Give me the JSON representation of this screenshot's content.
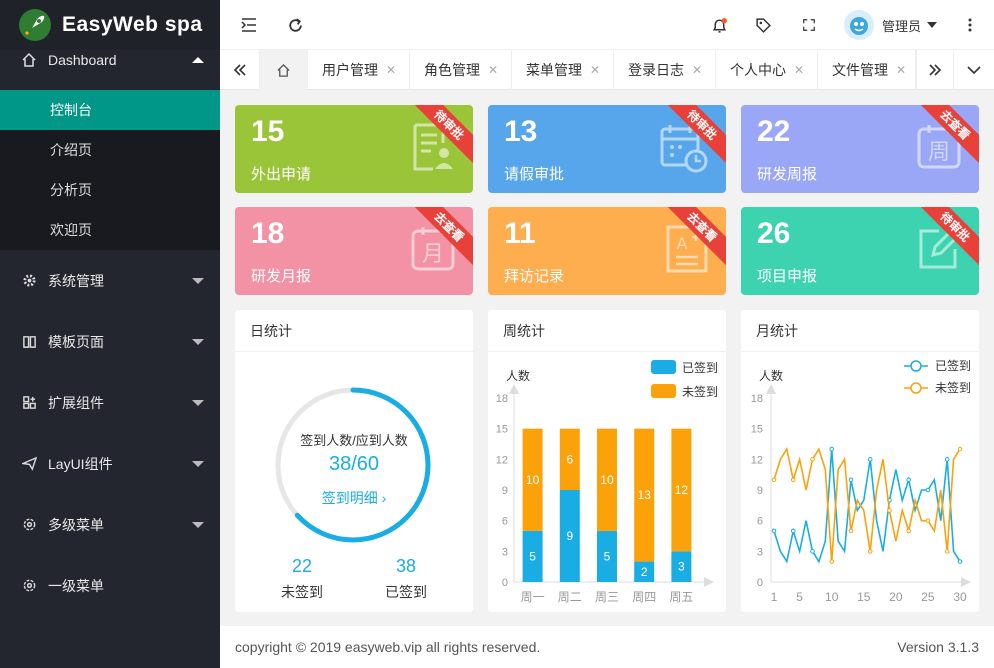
{
  "app": {
    "title": "EasyWeb spa"
  },
  "header": {
    "username": "管理员"
  },
  "sidebar": {
    "dashboard": "Dashboard",
    "dashboard_items": [
      "控制台",
      "介绍页",
      "分析页",
      "欢迎页"
    ],
    "items": [
      {
        "label": "系统管理",
        "icon": "gear-icon"
      },
      {
        "label": "模板页面",
        "icon": "book-icon"
      },
      {
        "label": "扩展组件",
        "icon": "grid-icon"
      },
      {
        "label": "LayUI组件",
        "icon": "send-icon"
      },
      {
        "label": "多级菜单",
        "icon": "settings-icon"
      },
      {
        "label": "一级菜单",
        "icon": "settings-icon"
      }
    ]
  },
  "tabs": [
    "用户管理",
    "角色管理",
    "菜单管理",
    "登录日志",
    "个人中心",
    "文件管理"
  ],
  "cards": [
    {
      "value": "15",
      "label": "外出申请",
      "badge": "待审批",
      "color": "#9bc539",
      "icon": "document-icon"
    },
    {
      "value": "13",
      "label": "请假审批",
      "badge": "待审批",
      "color": "#57a6ec",
      "icon": "calendar-icon"
    },
    {
      "value": "22",
      "label": "研发周报",
      "badge": "去查看",
      "color": "#9aa7f7",
      "icon": "week-icon"
    },
    {
      "value": "18",
      "label": "研发月报",
      "badge": "去查看",
      "color": "#f392a4",
      "icon": "month-icon"
    },
    {
      "value": "11",
      "label": "拜访记录",
      "badge": "去查看",
      "color": "#feae4f",
      "icon": "grade-icon"
    },
    {
      "value": "26",
      "label": "项目申报",
      "badge": "待审批",
      "color": "#3dd2b0",
      "icon": "edit-icon"
    }
  ],
  "daily": {
    "title": "日统计",
    "caption": "签到人数/应到人数",
    "ratio": "38/60",
    "progress": 0.633,
    "detail_link": "签到明细",
    "unsigned_value": "22",
    "unsigned_label": "未签到",
    "signed_value": "38",
    "signed_label": "已签到"
  },
  "weekly_title": "周统计",
  "monthly_title": "月统计",
  "chart_data": [
    {
      "type": "bar",
      "title": "周统计",
      "ylabel": "人数",
      "categories": [
        "周一",
        "周二",
        "周三",
        "周四",
        "周五"
      ],
      "series": [
        {
          "name": "已签到",
          "values": [
            5,
            9,
            5,
            2,
            3
          ],
          "color": "#1aade3"
        },
        {
          "name": "未签到",
          "values": [
            10,
            6,
            10,
            13,
            12
          ],
          "color": "#fba20a"
        }
      ],
      "stacked": true,
      "ylim": [
        0,
        18
      ],
      "yticks": [
        0,
        3,
        6,
        9,
        12,
        15,
        18
      ]
    },
    {
      "type": "line",
      "title": "月统计",
      "ylabel": "人数",
      "xticks": [
        1,
        5,
        10,
        15,
        20,
        25,
        30
      ],
      "x": [
        1,
        2,
        3,
        4,
        5,
        6,
        7,
        8,
        9,
        10,
        11,
        12,
        13,
        14,
        15,
        16,
        17,
        18,
        19,
        20,
        21,
        22,
        23,
        24,
        25,
        26,
        27,
        28,
        29,
        30
      ],
      "series": [
        {
          "name": "已签到",
          "color": "#1aade3",
          "values": [
            5,
            3,
            2,
            5,
            3,
            6,
            3,
            2,
            4,
            13,
            4,
            3,
            10,
            7,
            8,
            12,
            6,
            3,
            8,
            11,
            8,
            10,
            7,
            9,
            9,
            10,
            6,
            12,
            3,
            2
          ]
        },
        {
          "name": "未签到",
          "color": "#fba20a",
          "values": [
            10,
            12,
            13,
            10,
            12,
            9,
            12,
            13,
            11,
            2,
            11,
            12,
            5,
            8,
            7,
            3,
            9,
            12,
            7,
            4,
            7,
            5,
            8,
            6,
            6,
            5,
            9,
            3,
            12,
            13
          ]
        }
      ],
      "ylim": [
        0,
        18
      ],
      "yticks": [
        0,
        3,
        6,
        9,
        12,
        15,
        18
      ]
    }
  ],
  "footer": {
    "copyright": "copyright © 2019 easyweb.vip all rights reserved.",
    "version": "Version 3.1.3"
  }
}
